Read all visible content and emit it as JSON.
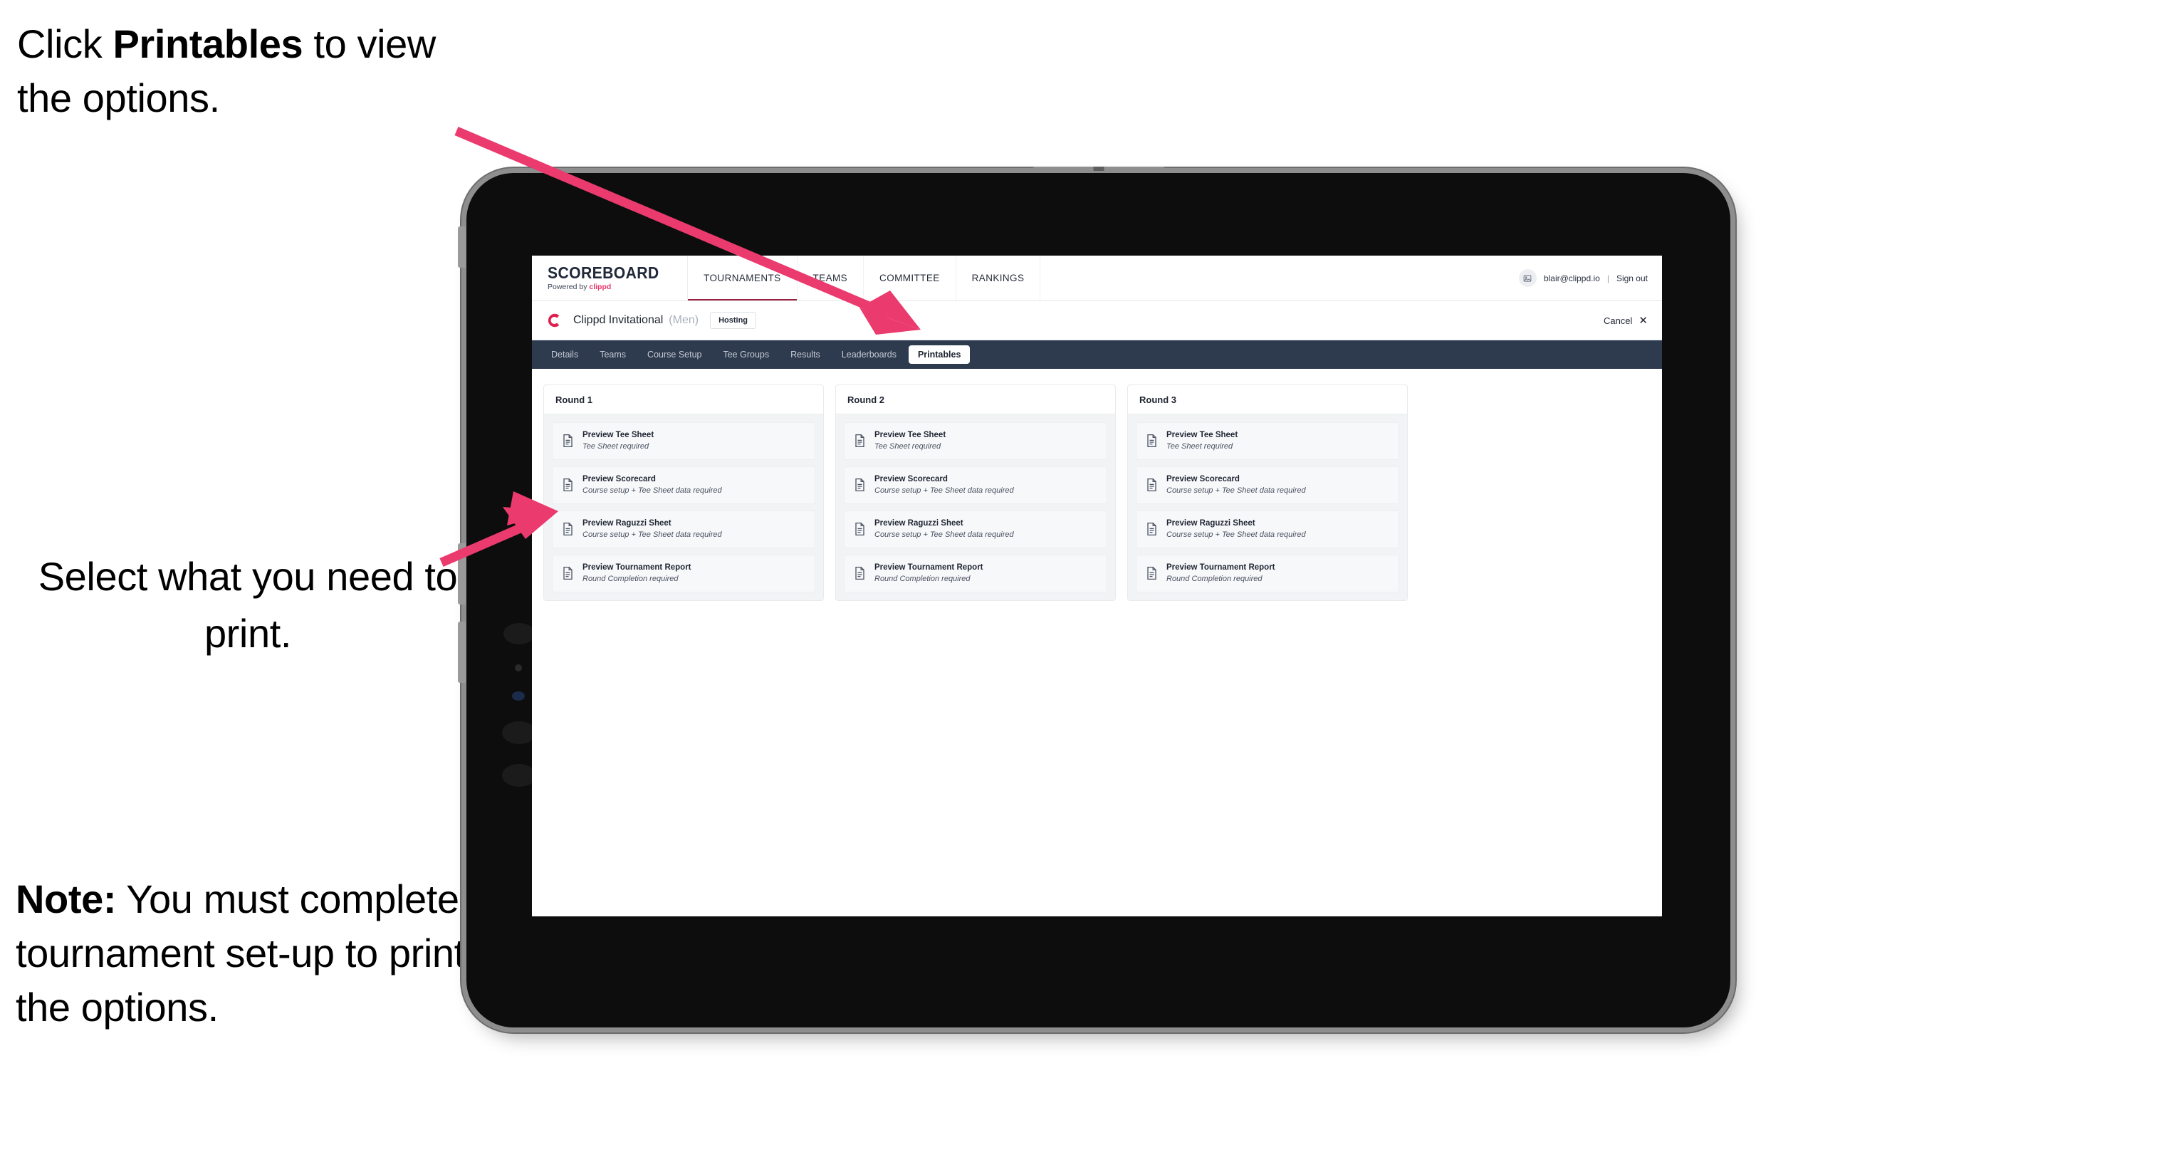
{
  "annotations": {
    "callout_1": {
      "prefix": "Click ",
      "bold": "Printables",
      "suffix": " to view the options."
    },
    "callout_2": {
      "text": "Select what you need to print."
    },
    "callout_3": {
      "bold": "Note:",
      "text": " You must complete the tournament set-up to print all the options."
    },
    "arrow_color": "#ea3a6e"
  },
  "app": {
    "logo": {
      "word": "SCOREBOARD",
      "powered_prefix": "Powered by ",
      "brand": "clippd"
    },
    "nav": [
      {
        "label": "TOURNAMENTS",
        "active": true
      },
      {
        "label": "TEAMS",
        "active": false
      },
      {
        "label": "COMMITTEE",
        "active": false
      },
      {
        "label": "RANKINGS",
        "active": false
      }
    ],
    "user": {
      "avatar_icon": "user-avatar-icon",
      "email": "blair@clippd.io",
      "separator": "|",
      "sign_out": "Sign out"
    },
    "tournament": {
      "mark_icon": "clippd-c-icon",
      "name": "Clippd Invitational",
      "gender": "(Men)",
      "status_chip": "Hosting",
      "cancel_label": "Cancel",
      "cancel_icon": "close-x-icon"
    },
    "subtabs": [
      {
        "label": "Details",
        "active": false
      },
      {
        "label": "Teams",
        "active": false
      },
      {
        "label": "Course Setup",
        "active": false
      },
      {
        "label": "Tee Groups",
        "active": false
      },
      {
        "label": "Results",
        "active": false
      },
      {
        "label": "Leaderboards",
        "active": false
      },
      {
        "label": "Printables",
        "active": true
      }
    ],
    "accent_colors": {
      "nav_underline": "#9b2040",
      "brand_pink": "#e8386a",
      "subtab_bar": "#2e3a4e"
    },
    "printables": {
      "rounds": [
        {
          "title": "Round 1",
          "items": [
            {
              "icon": "document-icon",
              "title": "Preview Tee Sheet",
              "subtitle": "Tee Sheet required"
            },
            {
              "icon": "document-icon",
              "title": "Preview Scorecard",
              "subtitle": "Course setup + Tee Sheet data required"
            },
            {
              "icon": "document-icon",
              "title": "Preview Raguzzi Sheet",
              "subtitle": "Course setup + Tee Sheet data required"
            },
            {
              "icon": "document-icon",
              "title": "Preview Tournament Report",
              "subtitle": "Round Completion required"
            }
          ]
        },
        {
          "title": "Round 2",
          "items": [
            {
              "icon": "document-icon",
              "title": "Preview Tee Sheet",
              "subtitle": "Tee Sheet required"
            },
            {
              "icon": "document-icon",
              "title": "Preview Scorecard",
              "subtitle": "Course setup + Tee Sheet data required"
            },
            {
              "icon": "document-icon",
              "title": "Preview Raguzzi Sheet",
              "subtitle": "Course setup + Tee Sheet data required"
            },
            {
              "icon": "document-icon",
              "title": "Preview Tournament Report",
              "subtitle": "Round Completion required"
            }
          ]
        },
        {
          "title": "Round 3",
          "items": [
            {
              "icon": "document-icon",
              "title": "Preview Tee Sheet",
              "subtitle": "Tee Sheet required"
            },
            {
              "icon": "document-icon",
              "title": "Preview Scorecard",
              "subtitle": "Course setup + Tee Sheet data required"
            },
            {
              "icon": "document-icon",
              "title": "Preview Raguzzi Sheet",
              "subtitle": "Course setup + Tee Sheet data required"
            },
            {
              "icon": "document-icon",
              "title": "Preview Tournament Report",
              "subtitle": "Round Completion required"
            }
          ]
        }
      ]
    }
  }
}
